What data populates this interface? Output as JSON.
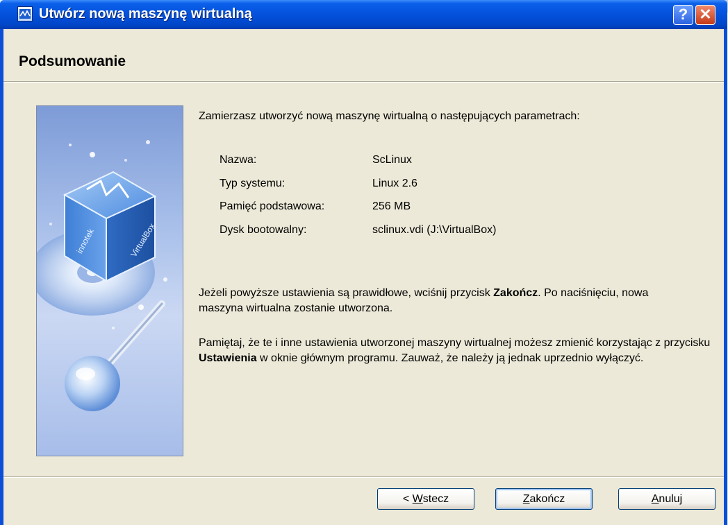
{
  "window": {
    "title": "Utwórz nową maszynę wirtualną",
    "help_label": "?",
    "close_label": "✕"
  },
  "page": {
    "title": "Podsumowanie",
    "intro": "Zamierzasz utworzyć nową maszynę wirtualną o następujących parametrach:"
  },
  "summary": [
    {
      "label": "Nazwa:",
      "value": "ScLinux"
    },
    {
      "label": "Typ systemu:",
      "value": "Linux 2.6"
    },
    {
      "label": "Pamięć podstawowa:",
      "value": "256 MB"
    },
    {
      "label": "Dysk bootowalny:",
      "value": "sclinux.vdi (J:\\VirtualBox)"
    }
  ],
  "para1": {
    "part1": "Jeżeli powyższe ustawienia są prawidłowe, wciśnij przycisk ",
    "bold": "Zakończ",
    "part2": ". Po naciśnięciu, nowa maszyna wirtualna zostanie utworzona."
  },
  "para2": {
    "part1": "Pamiętaj, że te i inne ustawienia utworzonej maszyny wirtualnej możesz zmienić korzystając z przycisku ",
    "bold": "Ustawienia",
    "part2": " w oknie głównym programu. Zauważ, że należy ją jednak uprzednio wyłączyć."
  },
  "buttons": {
    "back_prefix": "< ",
    "back_accel": "W",
    "back_rest": "stecz",
    "finish_accel": "Z",
    "finish_rest": "akończ",
    "cancel_accel": "A",
    "cancel_rest": "nuluj"
  },
  "side_image": {
    "cube_text_left": "innotek",
    "cube_text_right": "VirtualBox"
  },
  "colors": {
    "titlebar": "#0451dc",
    "dialog_bg": "#ece9d8",
    "side_bg": "#a9c0ea"
  }
}
